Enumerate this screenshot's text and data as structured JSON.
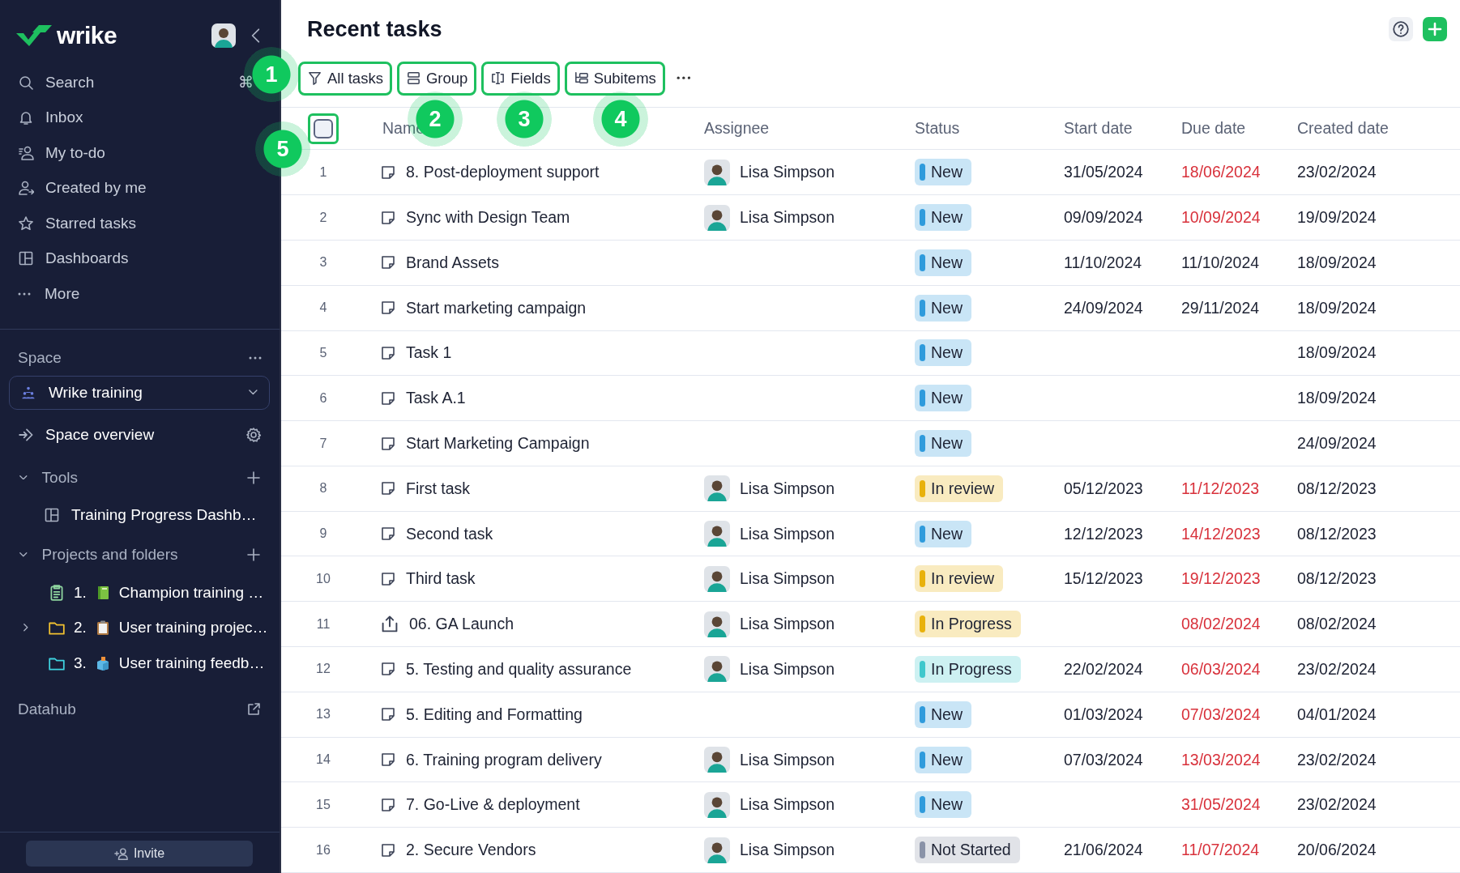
{
  "sidebar": {
    "logo": "wrike",
    "nav": [
      {
        "label": "Search",
        "shortcut": "⌘"
      },
      {
        "label": "Inbox"
      },
      {
        "label": "My to-do"
      },
      {
        "label": "Created by me"
      },
      {
        "label": "Starred tasks"
      },
      {
        "label": "Dashboards"
      },
      {
        "label": "More"
      }
    ],
    "space": {
      "heading": "Space",
      "current": "Wrike training"
    },
    "space_overview": "Space overview",
    "tools": {
      "heading": "Tools",
      "expanded": true,
      "items": [
        {
          "label": "Training Progress Dashb…"
        }
      ]
    },
    "projects": {
      "heading": "Projects and folders",
      "expanded": true,
      "items": [
        {
          "kind": "project",
          "number": "1.",
          "label": "Champion training …",
          "color": "#8fd6a0",
          "expandable": false
        },
        {
          "kind": "folder",
          "number": "2.",
          "label": "User training projec…",
          "color": "#f2c230",
          "expandable": true
        },
        {
          "kind": "folder",
          "number": "3.",
          "label": "User training feedb…",
          "color": "#3fd3e0",
          "expandable": false
        }
      ]
    },
    "datahub": "Datahub",
    "invite": "Invite"
  },
  "header": {
    "title": "Recent tasks"
  },
  "toolbar": [
    {
      "label": "All tasks",
      "highlighted": true
    },
    {
      "label": "Group",
      "highlighted": true
    },
    {
      "label": "Fields",
      "highlighted": true
    },
    {
      "label": "Subitems",
      "highlighted": true
    }
  ],
  "table": {
    "columns": [
      "Name",
      "Assignee",
      "Status",
      "Start date",
      "Due date",
      "Created date"
    ],
    "select_all": {
      "checked": false,
      "highlighted": true
    },
    "rows": [
      {
        "number": "1",
        "kind": "task",
        "name": "8. Post-deployment support",
        "assignee": "Lisa Simpson",
        "status": {
          "label": "New",
          "color": "#2f9bdc"
        },
        "start": "31/05/2024",
        "due": "18/06/2024",
        "overdue": true,
        "created": "23/02/2024"
      },
      {
        "number": "2",
        "kind": "task",
        "name": "Sync with Design Team",
        "assignee": "Lisa Simpson",
        "status": {
          "label": "New",
          "color": "#2f9bdc"
        },
        "start": "09/09/2024",
        "due": "10/09/2024",
        "overdue": true,
        "created": "19/09/2024"
      },
      {
        "number": "3",
        "kind": "task",
        "name": "Brand Assets",
        "status": {
          "label": "New",
          "color": "#2f9bdc"
        },
        "start": "11/10/2024",
        "due": "11/10/2024",
        "overdue": false,
        "created": "18/09/2024"
      },
      {
        "number": "4",
        "kind": "task",
        "name": "Start marketing campaign",
        "status": {
          "label": "New",
          "color": "#2f9bdc"
        },
        "start": "24/09/2024",
        "due": "29/11/2024",
        "overdue": false,
        "created": "18/09/2024"
      },
      {
        "number": "5",
        "kind": "task",
        "name": "Task 1",
        "status": {
          "label": "New",
          "color": "#2f9bdc"
        },
        "created": "18/09/2024"
      },
      {
        "number": "6",
        "kind": "task",
        "name": "Task A.1",
        "status": {
          "label": "New",
          "color": "#2f9bdc"
        },
        "created": "18/09/2024"
      },
      {
        "number": "7",
        "kind": "task",
        "name": "Start Marketing Campaign",
        "status": {
          "label": "New",
          "color": "#2f9bdc"
        },
        "created": "24/09/2024"
      },
      {
        "number": "8",
        "kind": "task",
        "name": "First task",
        "assignee": "Lisa Simpson",
        "status": {
          "label": "In review",
          "color": "#e8b10b"
        },
        "start": "05/12/2023",
        "due": "11/12/2023",
        "overdue": true,
        "created": "08/12/2023"
      },
      {
        "number": "9",
        "kind": "task",
        "name": "Second task",
        "assignee": "Lisa Simpson",
        "status": {
          "label": "New",
          "color": "#2f9bdc"
        },
        "start": "12/12/2023",
        "due": "14/12/2023",
        "overdue": true,
        "created": "08/12/2023"
      },
      {
        "number": "10",
        "kind": "task",
        "name": "Third task",
        "assignee": "Lisa Simpson",
        "status": {
          "label": "In review",
          "color": "#e8b10b"
        },
        "start": "15/12/2023",
        "due": "19/12/2023",
        "overdue": true,
        "created": "08/12/2023"
      },
      {
        "number": "11",
        "kind": "milestone",
        "name": "06. GA Launch",
        "assignee": "Lisa Simpson",
        "status": {
          "label": "In Progress",
          "color": "#e8b10b"
        },
        "due": "08/02/2024",
        "overdue": true,
        "created": "08/02/2024"
      },
      {
        "number": "12",
        "kind": "task",
        "name": "5. Testing and quality assurance",
        "assignee": "Lisa Simpson",
        "status": {
          "label": "In Progress",
          "color": "#3fc8cc"
        },
        "start": "22/02/2024",
        "due": "06/03/2024",
        "overdue": true,
        "created": "23/02/2024"
      },
      {
        "number": "13",
        "kind": "task",
        "name": "5. Editing and Formatting",
        "status": {
          "label": "New",
          "color": "#2f9bdc"
        },
        "start": "01/03/2024",
        "due": "07/03/2024",
        "overdue": true,
        "created": "04/01/2024"
      },
      {
        "number": "14",
        "kind": "task",
        "name": "6. Training program delivery",
        "assignee": "Lisa Simpson",
        "status": {
          "label": "New",
          "color": "#2f9bdc"
        },
        "start": "07/03/2024",
        "due": "13/03/2024",
        "overdue": true,
        "created": "23/02/2024"
      },
      {
        "number": "15",
        "kind": "task",
        "name": "7. Go-Live & deployment",
        "assignee": "Lisa Simpson",
        "status": {
          "label": "New",
          "color": "#2f9bdc"
        },
        "due": "31/05/2024",
        "overdue": true,
        "created": "23/02/2024"
      },
      {
        "number": "16",
        "kind": "task",
        "name": "2. Secure Vendors",
        "assignee": "Lisa Simpson",
        "status": {
          "label": "Not Started",
          "color": "#8a93a8"
        },
        "start": "21/06/2024",
        "due": "11/07/2024",
        "overdue": true,
        "created": "20/06/2024"
      }
    ]
  },
  "callouts": [
    {
      "label": "1"
    },
    {
      "label": "2"
    },
    {
      "label": "3"
    },
    {
      "label": "4"
    },
    {
      "label": "5"
    }
  ]
}
